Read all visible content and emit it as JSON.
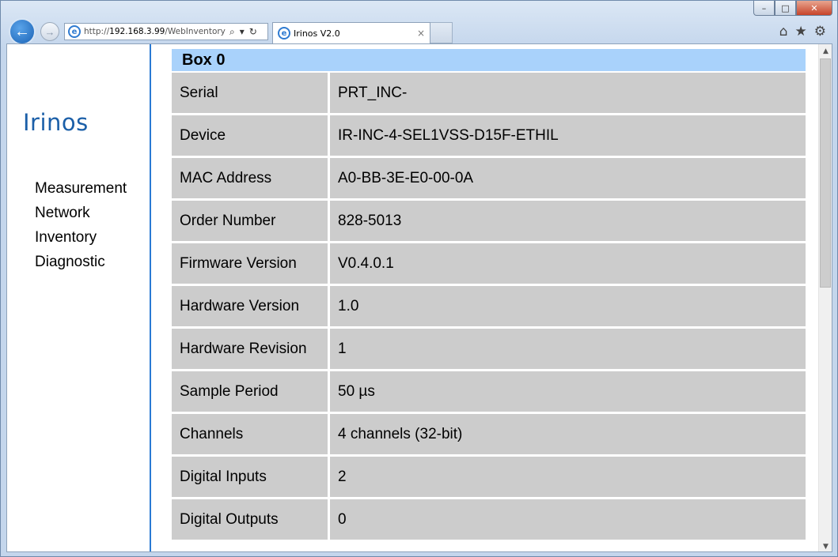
{
  "browser": {
    "address": {
      "prefix": "http://",
      "host": "192.168.3.99",
      "path": "/WebInventory"
    },
    "tab": {
      "title": "Irinos V2.0",
      "close": "×"
    },
    "icons": {
      "back": "arrow-left-icon",
      "forward": "arrow-right-icon",
      "search": "search-icon",
      "dropdown": "chevron-down-icon",
      "refresh": "refresh-icon",
      "home": "home-icon",
      "favorites": "star-icon",
      "tools": "gear-icon"
    },
    "window_controls": {
      "minimize": "–",
      "maximize": "□",
      "close": "✕"
    }
  },
  "sidebar": {
    "logo": "Irinos",
    "menu": [
      "Measurement",
      "Network",
      "Inventory",
      "Diagnostic"
    ]
  },
  "main": {
    "box_title": "Box 0",
    "rows": [
      {
        "key": "Serial",
        "value": "PRT_INC-"
      },
      {
        "key": "Device",
        "value": "IR-INC-4-SEL1VSS-D15F-ETHIL"
      },
      {
        "key": "MAC Address",
        "value": "A0-BB-3E-E0-00-0A"
      },
      {
        "key": "Order Number",
        "value": "828-5013"
      },
      {
        "key": "Firmware Version",
        "value": "V0.4.0.1"
      },
      {
        "key": "Hardware Version",
        "value": "1.0"
      },
      {
        "key": "Hardware Revision",
        "value": "1"
      },
      {
        "key": "Sample Period",
        "value": "50 µs"
      },
      {
        "key": "Channels",
        "value": "4 channels (32-bit)"
      },
      {
        "key": "Digital Inputs",
        "value": "2"
      },
      {
        "key": "Digital Outputs",
        "value": "0"
      }
    ]
  }
}
